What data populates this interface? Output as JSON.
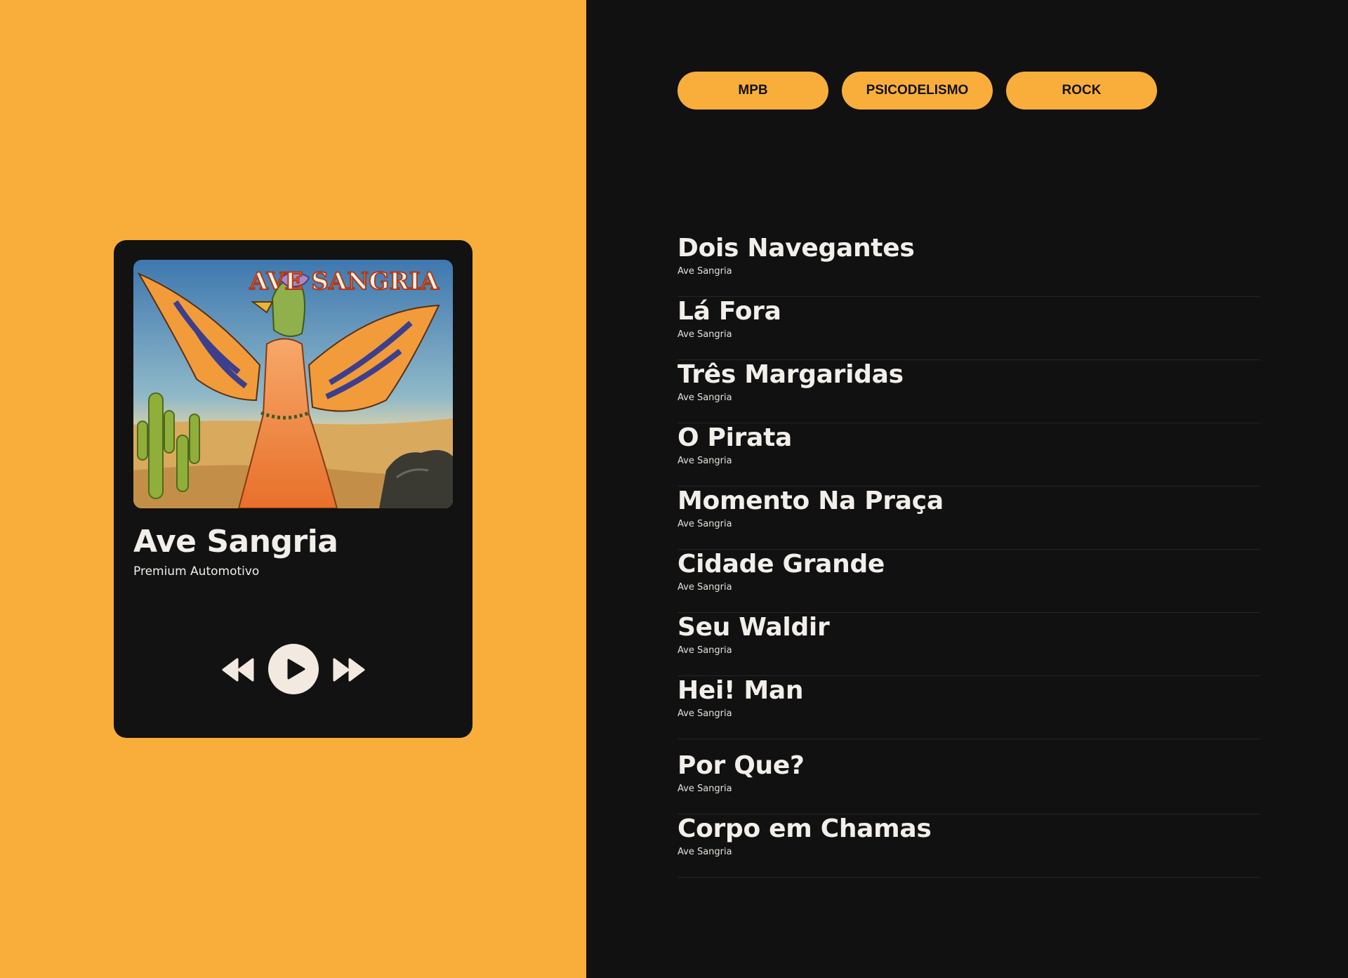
{
  "player": {
    "album_title": "Ave Sangria",
    "subtitle": "Premium Automotivo",
    "cover_text": "AVE SANGRIA",
    "icons": {
      "prev": "rewind-icon",
      "play": "play-icon",
      "next": "fast-forward-icon"
    }
  },
  "genres": [
    "MPB",
    "PSICODELISMO",
    "ROCK"
  ],
  "tracks": [
    {
      "title": "Dois Navegantes",
      "artist": "Ave Sangria"
    },
    {
      "title": "Lá Fora",
      "artist": "Ave Sangria"
    },
    {
      "title": "Três Margaridas",
      "artist": "Ave Sangria"
    },
    {
      "title": "O Pirata",
      "artist": "Ave Sangria"
    },
    {
      "title": "Momento Na Praça",
      "artist": "Ave Sangria"
    },
    {
      "title": "Cidade Grande",
      "artist": "Ave Sangria"
    },
    {
      "title": "Seu Waldir",
      "artist": "Ave Sangria"
    },
    {
      "title": "Hei! Man",
      "artist": "Ave Sangria"
    },
    {
      "title": "Por Que?",
      "artist": "Ave Sangria"
    },
    {
      "title": "Corpo em Chamas",
      "artist": "Ave Sangria"
    }
  ],
  "colors": {
    "accent": "#F9AE3B",
    "panel": "#111111",
    "card": "#121212",
    "text": "#F2EEE9"
  }
}
